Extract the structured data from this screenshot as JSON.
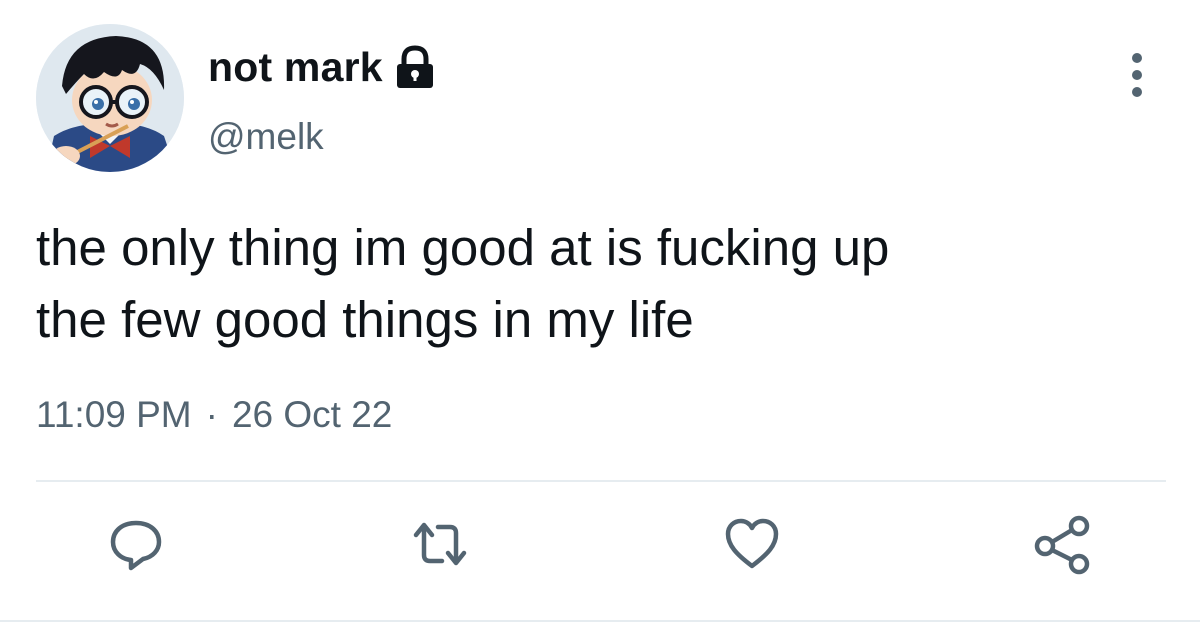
{
  "user": {
    "display_name": "not mark",
    "handle": "@melk",
    "protected_icon": "lock-icon",
    "avatar_icon": "anime-avatar"
  },
  "tweet": {
    "text_line_1": "the only thing im good at is fucking up",
    "text_line_2": "the few good things in my life",
    "time": "11:09 PM",
    "separator": "·",
    "date": "26 Oct 22"
  },
  "actions": {
    "more": "more-icon",
    "reply": "reply-icon",
    "retweet": "retweet-icon",
    "like": "heart-icon",
    "share": "share-icon"
  },
  "colors": {
    "text_primary": "#0f1419",
    "text_secondary": "#536471",
    "divider": "#e6ecf0",
    "icon": "#536471"
  }
}
